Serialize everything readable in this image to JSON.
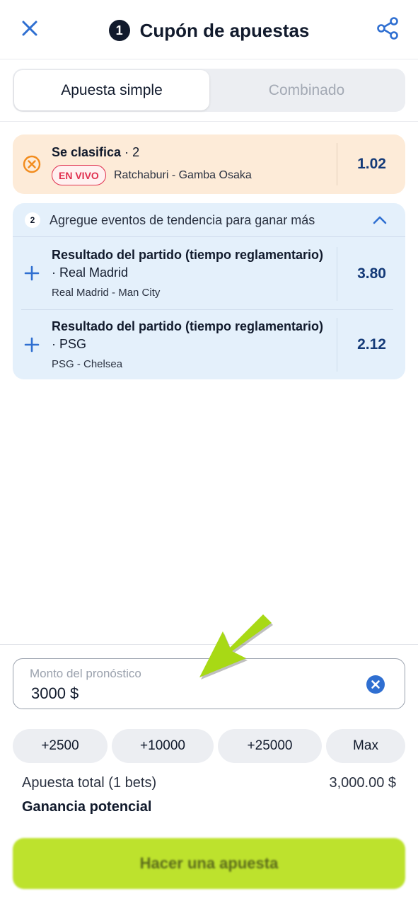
{
  "header": {
    "count": "1",
    "title": "Cupón de apuestas"
  },
  "tabs": [
    {
      "label": "Apuesta simple",
      "active": true
    },
    {
      "label": "Combinado",
      "active": false
    }
  ],
  "bet": {
    "market": "Se clasifica",
    "selection": "· 2",
    "live_label": "EN VIVO",
    "event": "Ratchaburi - Gamba Osaka",
    "odds": "1.02"
  },
  "suggestions": {
    "count": "2",
    "title": "Agregue eventos de tendencia para ganar más",
    "items": [
      {
        "market": "Resultado del partido (tiempo reglamentario)",
        "selection": "· Real Madrid",
        "event": "Real Madrid - Man City",
        "odds": "3.80"
      },
      {
        "market": "Resultado del partido (tiempo reglamentario)",
        "selection": "· PSG",
        "event": "PSG - Chelsea",
        "odds": "2.12"
      }
    ]
  },
  "stake": {
    "label": "Monto del pronóstico",
    "value": "3000 $"
  },
  "quick_amounts": [
    "+2500",
    "+10000",
    "+25000",
    "Max"
  ],
  "summary": {
    "total_label": "Apuesta total (1 bets)",
    "total_value": "3,000.00 $",
    "gain_label": "Ganancia potencial"
  },
  "place_bet_label": "Hacer una apuesta",
  "colors": {
    "accent": "#bde22d",
    "brand_blue": "#2f6fd1",
    "live_red": "#e0304f",
    "odds_text": "#143a78",
    "warning_orange": "#f28c1e"
  }
}
